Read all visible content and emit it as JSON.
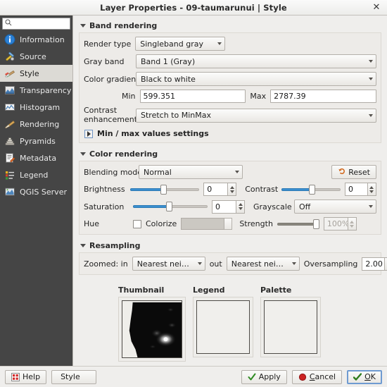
{
  "window": {
    "title": "Layer Properties - 09-taumarunui | Style",
    "close_icon": "close-icon"
  },
  "sidebar": {
    "search": {
      "value": "",
      "placeholder": "",
      "icon": "search-icon"
    },
    "items": [
      {
        "label": "Information",
        "icon": "information-icon",
        "selected": false
      },
      {
        "label": "Source",
        "icon": "source-icon",
        "selected": false
      },
      {
        "label": "Style",
        "icon": "style-brush-icon",
        "selected": true
      },
      {
        "label": "Transparency",
        "icon": "transparency-icon",
        "selected": false
      },
      {
        "label": "Histogram",
        "icon": "histogram-icon",
        "selected": false
      },
      {
        "label": "Rendering",
        "icon": "rendering-brush-icon",
        "selected": false
      },
      {
        "label": "Pyramids",
        "icon": "pyramids-icon",
        "selected": false
      },
      {
        "label": "Metadata",
        "icon": "metadata-icon",
        "selected": false
      },
      {
        "label": "Legend",
        "icon": "legend-icon",
        "selected": false
      },
      {
        "label": "QGIS Server",
        "icon": "qgis-server-icon",
        "selected": false
      }
    ]
  },
  "band_rendering": {
    "title": "Band rendering",
    "render_type_label": "Render type",
    "render_type_value": "Singleband gray",
    "gray_band_label": "Gray band",
    "gray_band_value": "Band 1 (Gray)",
    "color_gradient_label": "Color gradient",
    "color_gradient_value": "Black to white",
    "min_label": "Min",
    "min_value": "599.351",
    "max_label": "Max",
    "max_value": "2787.39",
    "contrast_label": "Contrast enhancement",
    "contrast_value": "Stretch to MinMax",
    "minmax_settings_label": "Min / max values settings"
  },
  "color_rendering": {
    "title": "Color rendering",
    "blending_label": "Blending mode",
    "blending_value": "Normal",
    "reset_label": "Reset",
    "reset_icon": "undo-icon",
    "brightness_label": "Brightness",
    "brightness_value": "0",
    "contrast_label": "Contrast",
    "contrast_value": "0",
    "saturation_label": "Saturation",
    "saturation_value": "0",
    "grayscale_label": "Grayscale",
    "grayscale_value": "Off",
    "hue_label": "Hue",
    "colorize_label": "Colorize",
    "colorize_checked": false,
    "strength_label": "Strength",
    "strength_value": "100%"
  },
  "resampling": {
    "title": "Resampling",
    "zoomed_in_label": "Zoomed: in",
    "zoomed_in_value": "Nearest neighbour",
    "zoomed_out_label": "out",
    "zoomed_out_value": "Nearest neighbour",
    "oversampling_label": "Oversampling",
    "oversampling_value": "2.00"
  },
  "previews": {
    "thumbnail_label": "Thumbnail",
    "legend_label": "Legend",
    "palette_label": "Palette"
  },
  "buttons": {
    "help_label": "Help",
    "help_icon": "help-icon",
    "style_label": "Style",
    "apply_label": "Apply",
    "apply_icon": "check-icon",
    "cancel_label": "Cancel",
    "cancel_icon": "stop-icon",
    "ok_label": "OK",
    "ok_icon": "check-thumb-icon"
  },
  "colors": {
    "sidebar_bg": "#454545",
    "selected_bg": "#dcdad5",
    "slider_blue": "#3a8fd0",
    "reset_orange": "#d2691e",
    "apply_green": "#2e8b22",
    "cancel_red": "#cc2222",
    "dialog_bg": "#efeeec"
  }
}
